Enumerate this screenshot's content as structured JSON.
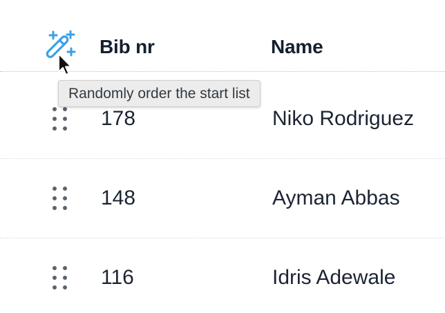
{
  "header": {
    "shuffle_icon": "magic-wand-icon",
    "columns": [
      "Bib nr",
      "Name"
    ]
  },
  "tooltip": {
    "text": "Randomly order the start list"
  },
  "rows": [
    {
      "bib": "178",
      "name": "Niko Rodriguez"
    },
    {
      "bib": "148",
      "name": "Ayman Abbas"
    },
    {
      "bib": "116",
      "name": "Idris Adewale"
    }
  ],
  "colors": {
    "accent": "#3aa0e8",
    "text": "#1b2433",
    "handle": "#5a6470"
  }
}
